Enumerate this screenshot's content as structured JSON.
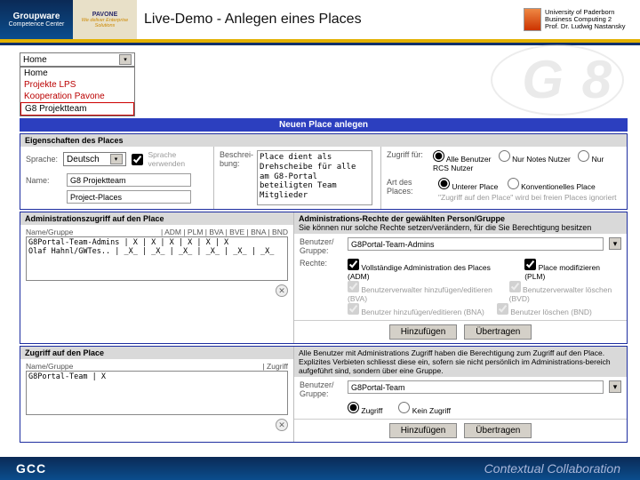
{
  "header": {
    "logo1_top": "Groupware",
    "logo1_bot": "Competence Center",
    "logo2_brand": "PAVONE",
    "logo2_tag": "We deliver Enterprise Solutions",
    "title": "Live-Demo - Anlegen eines Places",
    "uni_l1": "University of Paderborn",
    "uni_l2": "Business Computing 2",
    "uni_l3": "Prof. Dr. Ludwig Nastansky"
  },
  "watermark": "G 8",
  "nav_dropdown": {
    "selected": "Home",
    "items": [
      "Home",
      "Projekte LPS",
      "Kooperation Pavone",
      "G8 Projektteam"
    ]
  },
  "bar_new_place": "Neuen Place anlegen",
  "props": {
    "heading": "Eigenschaften des Places",
    "lang_label": "Sprache:",
    "lang_value": "Deutsch",
    "lang_aux": "Sprache verwenden",
    "name_label": "Name:",
    "name_value": "G8 Projektteam",
    "path_value": "Project-Places",
    "desc_label": "Beschrei-\nbung:",
    "desc_value": "Place dient als\nDrehscheibe für alle\nam G8-Portal\nbeteiligten Team\nMitglieder",
    "access_label": "Zugriff für:",
    "access_opts": [
      "Alle Benutzer",
      "Nur Notes Nutzer",
      "Nur RCS Nutzer"
    ],
    "artdes_label": "Art des\nPlaces:",
    "artdes_opts": [
      "Unterer Place",
      "Konventionelles Place"
    ],
    "artdes_note": "\"Zugriff auf den Place\" wird bei freien Places ignoriert"
  },
  "admin": {
    "left_head": "Administrationszugriff auf den Place",
    "namegrp_label": "Name/Gruppe",
    "rights_cols": "| ADM | PLM | BVA | BVE | BNA | BND",
    "row1": "G8Portal-Team-Admins |  X  |  X  |  X  |  X  |  X  |  X",
    "row2": "Olaf Hahnl/GWTes..   | _X_ | _X_ | _X_ | _X_ | _X_ | _X_",
    "right_head": "Administrations-Rechte der gewählten Person/Gruppe",
    "right_sub": "Sie können nur solche Rechte setzen/verändern, für die Sie Berechtigung besitzen",
    "grp_label": "Benutzer/\nGruppe:",
    "grp_value": "G8Portal-Team-Admins",
    "rights_label": "Rechte:",
    "r1": "Vollständige Administration des Places (ADM)",
    "r2": "Place modifizieren (PLM)",
    "r3": "Benutzerverwalter hinzufügen/editieren (BVA)",
    "r4": "Benutzerverwalter löschen (BVD)",
    "r5": "Benutzer hinzufügen/editieren (BNA)",
    "r6": "Benutzer löschen (BND)",
    "btn_add": "Hinzufügen",
    "btn_apply": "Übertragen"
  },
  "access": {
    "heading": "Zugriff auf den Place",
    "namegrp_label": "Name/Gruppe",
    "col2": "| Zugriff",
    "row1": "G8Portal-Team        |  X",
    "right_note": "Alle Benutzer mit Administrations Zugriff haben die Berechtigung zum Zugriff auf den Place. Explizites Verbieten schliesst diese ein, sofern sie nicht persönlich im Administrations-bereich aufgeführt sind, sondern über eine Gruppe.",
    "grp_label": "Benutzer/\nGruppe:",
    "grp_value": "G8Portal-Team",
    "opt1": "Zugriff",
    "opt2": "Kein Zugriff",
    "btn_add": "Hinzufügen",
    "btn_apply": "Übertragen"
  },
  "footer": {
    "left": "GCC",
    "right": "Contextual Collaboration"
  }
}
